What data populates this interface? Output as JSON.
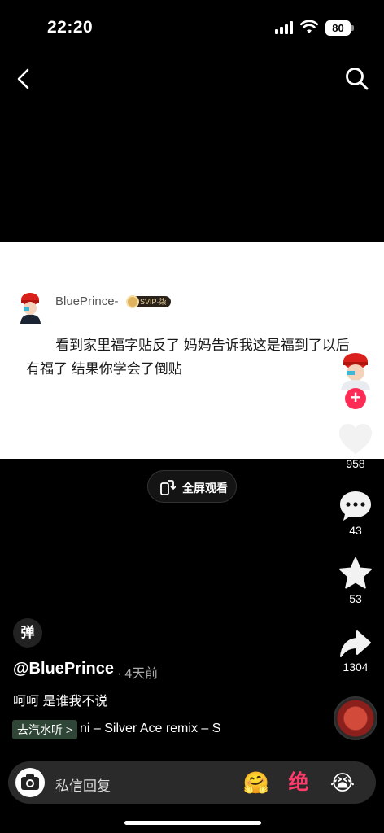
{
  "status_bar": {
    "time": "22:20",
    "battery": "80"
  },
  "post": {
    "username": "BluePrince-",
    "badge": "SVIP·柒",
    "text": "看到家里福字贴反了 妈妈告诉我这是福到了以后有福了 结果你学会了倒贴"
  },
  "fullscreen": {
    "label": "全屏观看"
  },
  "actions": {
    "likes": "958",
    "comments": "43",
    "favorites": "53",
    "shares": "1304"
  },
  "danmu": {
    "label": "弹"
  },
  "author": {
    "handle": "@BluePrince",
    "time": "4天前"
  },
  "caption": "呵呵 是谁我不说",
  "music": {
    "app_button": "去汽水听 >",
    "title": "ni – Silver Ace remix – S"
  },
  "reply_bar": {
    "placeholder": "私信回复",
    "emoji_jue": "绝"
  },
  "colors": {
    "accent": "#fe2c55",
    "card_bg": "#ffffff",
    "bg": "#000000"
  }
}
